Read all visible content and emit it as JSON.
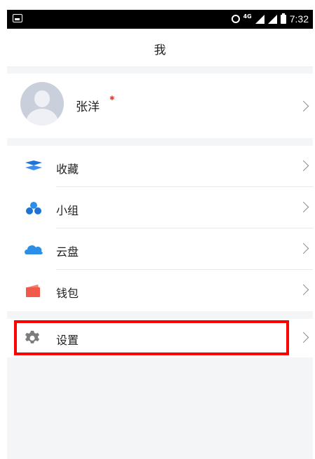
{
  "statusbar": {
    "network": "4G",
    "time": "7:32"
  },
  "header": {
    "title": "我"
  },
  "profile": {
    "name": "张洋"
  },
  "menu": [
    {
      "label": "收藏",
      "icon": "favorites-icon",
      "color": "#1e73d6"
    },
    {
      "label": "小组",
      "icon": "group-icon",
      "color": "#1e73d6"
    },
    {
      "label": "云盘",
      "icon": "cloud-icon",
      "color": "#2b8fe8"
    },
    {
      "label": "钱包",
      "icon": "wallet-icon",
      "color": "#f05a4a"
    }
  ],
  "settings": {
    "label": "设置",
    "icon": "gear-icon",
    "highlight_color": "#ff0000"
  }
}
